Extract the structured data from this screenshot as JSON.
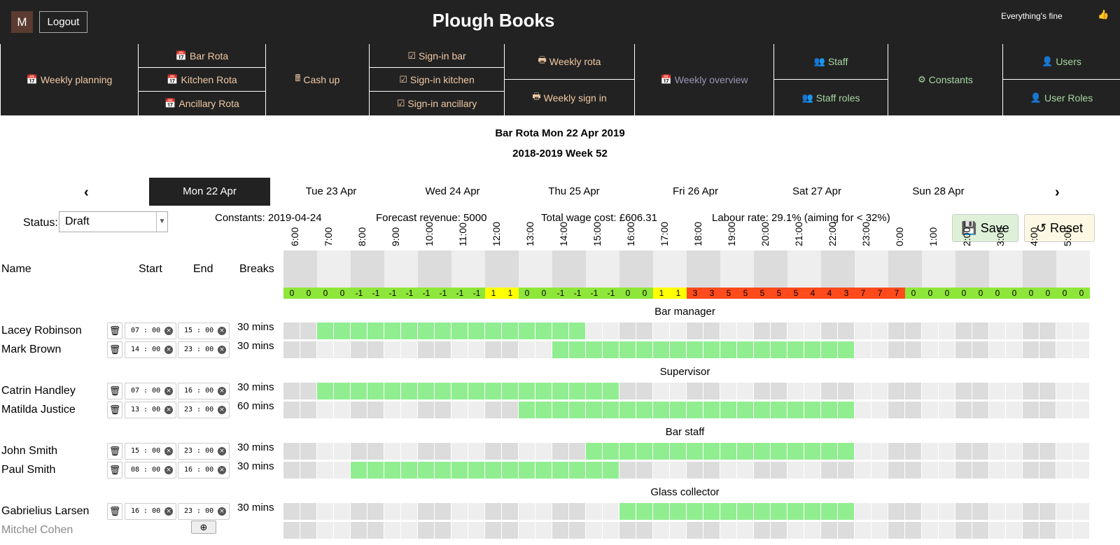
{
  "header": {
    "avatar": "M",
    "logout": "Logout",
    "title": "Plough Books",
    "status": "Everything's fine",
    "status_icon": "thumbs-up-icon"
  },
  "nav": [
    {
      "label": "Weekly planning",
      "icon": "calendar-icon",
      "color": "orange"
    },
    {
      "label": "Bar Rota",
      "icon": "calendar-icon",
      "color": "orange"
    },
    {
      "label": "Kitchen Rota",
      "icon": "calendar-icon",
      "color": "orange"
    },
    {
      "label": "Ancillary Rota",
      "icon": "calendar-icon",
      "color": "orange"
    },
    {
      "label": "Cash up",
      "icon": "cash-register-icon",
      "color": "orange"
    },
    {
      "label": "Sign-in bar",
      "icon": "calendar-check-icon",
      "color": "orange"
    },
    {
      "label": "Sign-in kitchen",
      "icon": "calendar-check-icon",
      "color": "orange"
    },
    {
      "label": "Sign-in ancillary",
      "icon": "calendar-check-icon",
      "color": "orange"
    },
    {
      "label": "Weekly rota",
      "icon": "print-icon",
      "color": "orange"
    },
    {
      "label": "Weekly sign in",
      "icon": "print-icon",
      "color": "orange"
    },
    {
      "label": "Weekly overview",
      "icon": "calendar-icon",
      "color": "gray"
    },
    {
      "label": "Staff",
      "icon": "users-icon",
      "color": "green"
    },
    {
      "label": "Staff roles",
      "icon": "users-cog-icon",
      "color": "green"
    },
    {
      "label": "Constants",
      "icon": "cogs-icon",
      "color": "green"
    },
    {
      "label": "Users",
      "icon": "user-icon",
      "color": "green"
    },
    {
      "label": "User Roles",
      "icon": "user-cog-icon",
      "color": "green"
    }
  ],
  "page": {
    "title": "Bar Rota Mon 22 Apr 2019",
    "subtitle": "2018-2019 Week 52"
  },
  "days": [
    "Mon 22 Apr",
    "Tue 23 Apr",
    "Wed 24 Apr",
    "Thu 25 Apr",
    "Fri 26 Apr",
    "Sat 27 Apr",
    "Sun 28 Apr"
  ],
  "active_day": 0,
  "status": {
    "label": "Status:",
    "value": "Draft"
  },
  "info": {
    "constants": "Constants: 2019-04-24",
    "forecast": "Forecast revenue: 5000",
    "wage": "Total wage cost: £606.31",
    "labour": "Labour rate: 29.1% (aiming for < 32%)"
  },
  "buttons": {
    "save": "Save",
    "reset": "Reset"
  },
  "columns": {
    "name": "Name",
    "start": "Start",
    "end": "End",
    "breaks": "Breaks"
  },
  "hours": [
    "6:00",
    "7:00",
    "8:00",
    "9:00",
    "10:00",
    "11:00",
    "12:00",
    "13:00",
    "14:00",
    "15:00",
    "16:00",
    "17:00",
    "18:00",
    "19:00",
    "20:00",
    "21:00",
    "22:00",
    "23:00",
    "0:00",
    "1:00",
    "2:00",
    "3:00",
    "4:00",
    "5:00"
  ],
  "counts": [
    "0",
    "0",
    "0",
    "0",
    "-1",
    "-1",
    "-1",
    "-1",
    "-1",
    "-1",
    "-1",
    "-1",
    "1",
    "1",
    "0",
    "0",
    "-1",
    "-1",
    "-1",
    "-1",
    "0",
    "0",
    "1",
    "1",
    "3",
    "3",
    "5",
    "5",
    "5",
    "5",
    "5",
    "4",
    "4",
    "3",
    "7",
    "7",
    "7",
    "0",
    "0",
    "0",
    "0",
    "0",
    "0",
    "0",
    "0",
    "0",
    "0",
    "0"
  ],
  "count_colors": {
    "green": "#8ee63a",
    "yellow": "#ffff00",
    "red": "#ff4a1c"
  },
  "shift_color": "#90ee90",
  "roles": [
    {
      "name": "Bar manager",
      "staff": [
        {
          "name": "Lacey Robinson",
          "start": "07:00",
          "end": "15:00",
          "breaks": "30 mins"
        },
        {
          "name": "Mark Brown",
          "start": "14:00",
          "end": "23:00",
          "breaks": "30 mins"
        }
      ]
    },
    {
      "name": "Supervisor",
      "staff": [
        {
          "name": "Catrin Handley",
          "start": "07:00",
          "end": "16:00",
          "breaks": "30 mins"
        },
        {
          "name": "Matilda Justice",
          "start": "13:00",
          "end": "23:00",
          "breaks": "60 mins"
        }
      ]
    },
    {
      "name": "Bar staff",
      "staff": [
        {
          "name": "John Smith",
          "start": "15:00",
          "end": "23:00",
          "breaks": "30 mins"
        },
        {
          "name": "Paul Smith",
          "start": "08:00",
          "end": "16:00",
          "breaks": "30 mins"
        }
      ]
    },
    {
      "name": "Glass collector",
      "staff": [
        {
          "name": "Gabrielius Larsen",
          "start": "16:00",
          "end": "23:00",
          "breaks": "30 mins"
        },
        {
          "name": "Mitchel Cohen",
          "start": "",
          "end": "",
          "breaks": ""
        }
      ]
    }
  ]
}
